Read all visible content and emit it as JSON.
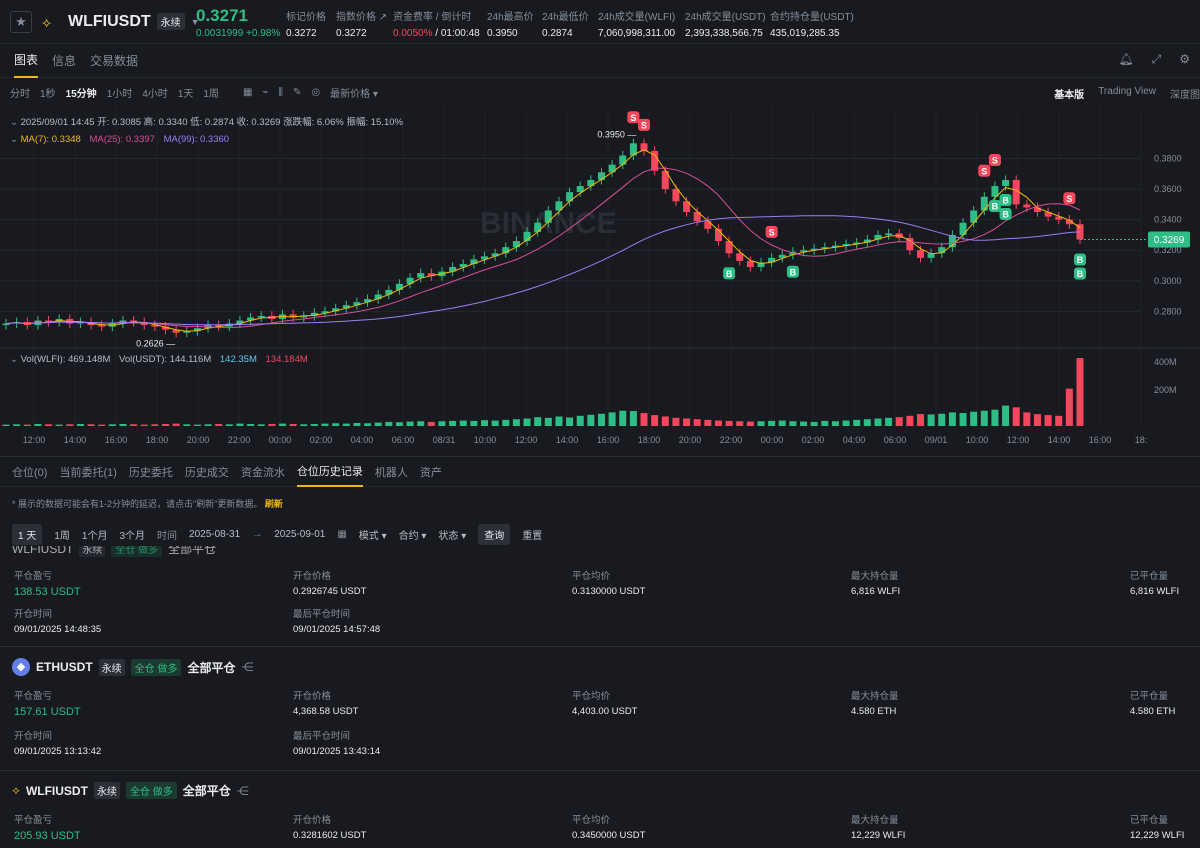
{
  "header": {
    "symbol": "WLFIUSDT",
    "contract_type": "永续",
    "last_price": "0.3271",
    "change": "0.0031999 +0.98%",
    "stats": [
      {
        "label": "标记价格",
        "value": "0.3272"
      },
      {
        "label": "指数价格 ↗",
        "value": "0.3272"
      },
      {
        "label": "资金费率 / 倒计时",
        "value_a": "0.0050%",
        "value_b": "/ 01:00:48"
      },
      {
        "label": "24h最高价",
        "value": "0.3950"
      },
      {
        "label": "24h最低价",
        "value": "0.2874"
      },
      {
        "label": "24h成交量(WLFI)",
        "value": "7,060,998,311.00"
      },
      {
        "label": "24h成交量(USDT)",
        "value": "2,393,338,566.75"
      },
      {
        "label": "合约持仓量(USDT)",
        "value": "435,019,285.35"
      }
    ]
  },
  "main_tabs": [
    "图表",
    "信息",
    "交易数据"
  ],
  "toolbar": {
    "intervals": [
      "分时",
      "1秒",
      "15分钟",
      "1小时",
      "4小时",
      "1天",
      "1周"
    ],
    "active_interval": "15分钟",
    "price_type": "最新价格 ▾",
    "views": [
      "基本版",
      "Trading View",
      "深度图"
    ]
  },
  "chart_legend": {
    "ohlc": "2025/09/01 14:45  开: 0.3085  高: 0.3340  低: 0.2874  收: 0.3269  涨跌幅: 6.06%  振幅: 15.10%",
    "ma7": "MA(7): 0.3348",
    "ma25": "MA(25): 0.3397",
    "ma99": "MA(99): 0.3360",
    "vol": "Vol(WLFI): 469.148M",
    "vol_usdt": "Vol(USDT): 144.116M",
    "vol_ma1": "142.35M",
    "vol_ma2": "134.184M"
  },
  "chart_data": {
    "type": "candlestick",
    "interval": "15分钟",
    "y_ticks": [
      "0.3800",
      "0.3600",
      "0.3400",
      "0.3200",
      "0.3000",
      "0.2800"
    ],
    "ylim": [
      0.256,
      0.4
    ],
    "vol_ticks": [
      "400M",
      "200M"
    ],
    "x_ticks": [
      "12:00",
      "14:00",
      "16:00",
      "18:00",
      "20:00",
      "22:00",
      "00:00",
      "02:00",
      "04:00",
      "06:00",
      "08/31",
      "10:00",
      "12:00",
      "14:00",
      "16:00",
      "18:00",
      "20:00",
      "22:00",
      "00:00",
      "02:00",
      "04:00",
      "06:00",
      "09/01",
      "10:00",
      "12:00",
      "14:00",
      "16:00",
      "18:"
    ],
    "current_price_label": "0.3269",
    "high_label": "0.3950",
    "low_label": "0.2626",
    "closes": [
      0.272,
      0.273,
      0.271,
      0.274,
      0.273,
      0.275,
      0.272,
      0.273,
      0.271,
      0.27,
      0.272,
      0.274,
      0.273,
      0.271,
      0.27,
      0.268,
      0.266,
      0.267,
      0.269,
      0.271,
      0.27,
      0.272,
      0.274,
      0.276,
      0.277,
      0.275,
      0.278,
      0.276,
      0.277,
      0.279,
      0.28,
      0.282,
      0.284,
      0.286,
      0.288,
      0.291,
      0.294,
      0.298,
      0.302,
      0.305,
      0.303,
      0.306,
      0.309,
      0.311,
      0.314,
      0.316,
      0.318,
      0.322,
      0.326,
      0.332,
      0.338,
      0.346,
      0.352,
      0.358,
      0.362,
      0.366,
      0.371,
      0.376,
      0.382,
      0.39,
      0.385,
      0.372,
      0.36,
      0.352,
      0.345,
      0.339,
      0.334,
      0.326,
      0.318,
      0.313,
      0.309,
      0.312,
      0.315,
      0.317,
      0.319,
      0.32,
      0.321,
      0.322,
      0.323,
      0.324,
      0.325,
      0.327,
      0.33,
      0.331,
      0.328,
      0.32,
      0.315,
      0.318,
      0.322,
      0.33,
      0.338,
      0.346,
      0.355,
      0.362,
      0.366,
      0.35,
      0.348,
      0.345,
      0.342,
      0.34,
      0.337,
      0.327
    ],
    "volumes": [
      4,
      5,
      4,
      6,
      5,
      4,
      5,
      6,
      5,
      4,
      5,
      6,
      5,
      4,
      5,
      6,
      7,
      5,
      4,
      5,
      6,
      5,
      7,
      6,
      5,
      6,
      7,
      6,
      5,
      6,
      7,
      8,
      7,
      9,
      8,
      10,
      12,
      11,
      13,
      14,
      12,
      14,
      15,
      16,
      15,
      17,
      16,
      18,
      20,
      22,
      26,
      24,
      28,
      25,
      30,
      33,
      36,
      40,
      45,
      44,
      38,
      32,
      28,
      24,
      22,
      20,
      18,
      16,
      15,
      14,
      13,
      14,
      15,
      16,
      14,
      13,
      12,
      15,
      14,
      16,
      18,
      20,
      22,
      24,
      26,
      30,
      35,
      34,
      36,
      40,
      38,
      42,
      45,
      48,
      60,
      55,
      40,
      35,
      32,
      30,
      110,
      200
    ],
    "signals": [
      {
        "type": "S",
        "index": 59
      },
      {
        "type": "S",
        "index": 60
      },
      {
        "type": "B",
        "index": 68
      },
      {
        "type": "S",
        "index": 72
      },
      {
        "type": "B",
        "index": 74
      },
      {
        "type": "S",
        "index": 92
      },
      {
        "type": "S",
        "index": 93
      },
      {
        "type": "B",
        "index": 93
      },
      {
        "type": "B",
        "index": 94
      },
      {
        "type": "B",
        "index": 94
      },
      {
        "type": "S",
        "index": 100
      },
      {
        "type": "B",
        "index": 101
      },
      {
        "type": "B",
        "index": 101
      }
    ]
  },
  "bottom_tabs": [
    "仓位(0)",
    "当前委托(1)",
    "历史委托",
    "历史成交",
    "资金流水",
    "仓位历史记录",
    "机器人",
    "资产"
  ],
  "notice": {
    "text": "* 展示的数据可能会有1-2分钟的延迟，请点击\"刷新\"更新数据。",
    "refresh": "刷新"
  },
  "filters": {
    "ranges": [
      "1 天",
      "1周",
      "1个月",
      "3个月"
    ],
    "time_label": "时间",
    "from": "2025-08-31",
    "arrow": "→",
    "to": "2025-09-01",
    "mode": "模式 ▾",
    "contract": "合约 ▾",
    "status": "状态 ▾",
    "query": "查询",
    "reset": "重置"
  },
  "labels": {
    "pnl": "平仓盈亏",
    "open_price": "开仓价格",
    "close_avg": "平仓均价",
    "max_pos": "最大持仓量",
    "closed_qty": "已平仓量",
    "open_time": "开仓时间",
    "last_close_time": "最后平仓时间"
  },
  "records": [
    {
      "symbol": "WLFIUSDT",
      "type": "永续",
      "tag": "全仓 做多",
      "status": "全部平仓",
      "pnl": "138.53 USDT",
      "open_price": "0.2926745 USDT",
      "close_avg": "0.3130000 USDT",
      "max_pos": "6,816 WLFI",
      "closed_qty": "6,816 WLFI",
      "open_time": "09/01/2025 14:48:35",
      "last_close_time": "09/01/2025 14:57:48"
    },
    {
      "symbol": "ETHUSDT",
      "type": "永续",
      "tag": "全仓 做多",
      "status": "全部平仓",
      "pnl": "157.61 USDT",
      "open_price": "4,368.58 USDT",
      "close_avg": "4,403.00 USDT",
      "max_pos": "4.580 ETH",
      "closed_qty": "4.580 ETH",
      "open_time": "09/01/2025 13:13:42",
      "last_close_time": "09/01/2025 13:43:14"
    },
    {
      "symbol": "WLFIUSDT",
      "type": "永续",
      "tag": "全仓 做多",
      "status": "全部平仓",
      "pnl": "205.93 USDT",
      "open_price": "0.3281602 USDT",
      "close_avg": "0.3450000 USDT",
      "max_pos": "12,229 WLFI",
      "closed_qty": "12,229 WLFI"
    }
  ],
  "colors": {
    "up": "#2ebd85",
    "down": "#f6465d",
    "accent": "#f0b90b",
    "ma7": "#f0b90b",
    "ma25": "#d64f9a",
    "ma99": "#9c7ef5"
  }
}
